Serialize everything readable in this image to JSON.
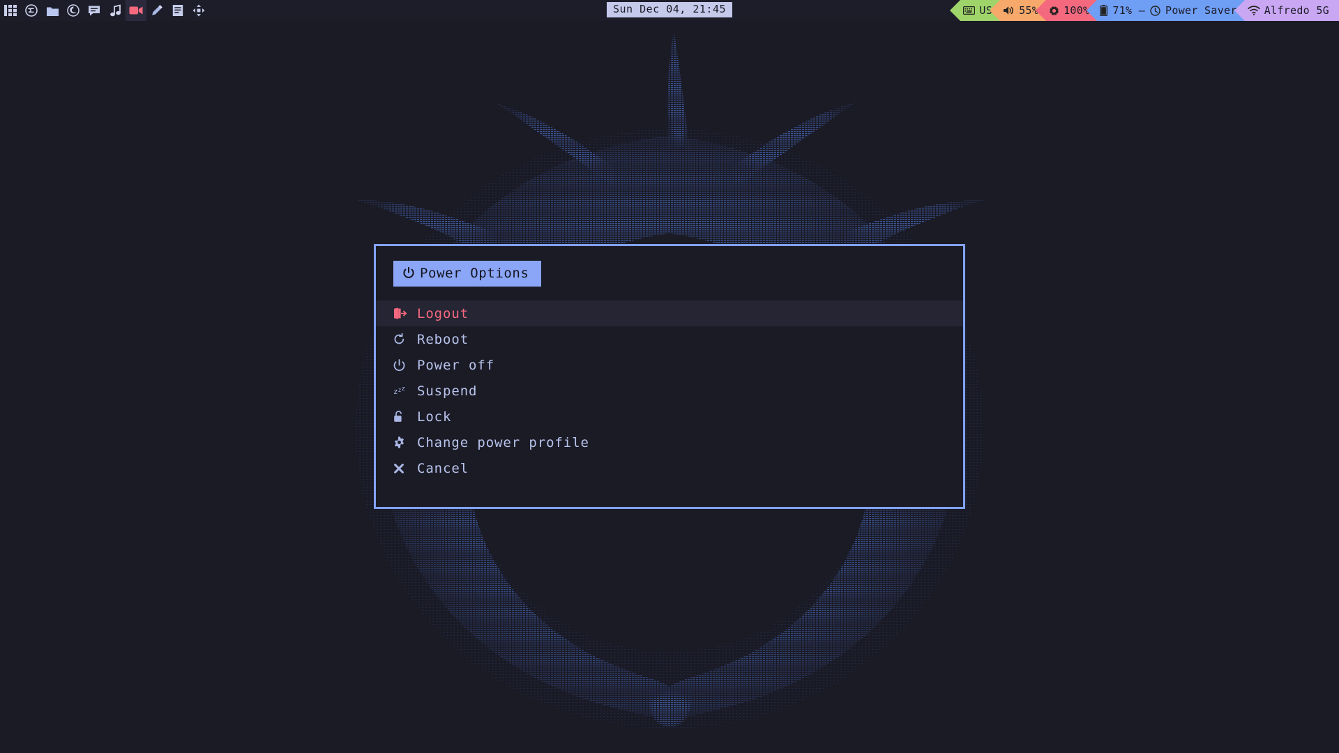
{
  "desktop": {
    "background_color": "#1b1b26",
    "wallpaper_name": "ascii-dithered-phoenix-wreath",
    "wallpaper_ink_color": "#3f5a9e"
  },
  "topbar": {
    "background_color": "#1d1d2a",
    "launchers": [
      {
        "name": "app-grid-icon",
        "title": "Applications"
      },
      {
        "name": "emacs-icon",
        "title": "Emacs"
      },
      {
        "name": "folder-icon",
        "title": "Files"
      },
      {
        "name": "firefox-icon",
        "title": "Firefox"
      },
      {
        "name": "chat-icon",
        "title": "Chat"
      },
      {
        "name": "music-note-icon",
        "title": "Music"
      },
      {
        "name": "video-camera-icon",
        "title": "Video",
        "active": true
      },
      {
        "name": "pencil-icon",
        "title": "Draw"
      },
      {
        "name": "document-icon",
        "title": "Notes"
      },
      {
        "name": "move-arrows-icon",
        "title": "Layout"
      }
    ],
    "clock": {
      "text": "Sun Dec 04, 21:45",
      "background_color": "#c5c9ea",
      "text_color": "#1b1b26"
    },
    "status_segments": [
      {
        "name": "keyboard-layout",
        "icon": "keyboard-icon",
        "label": "US",
        "color": "#9fd46a"
      },
      {
        "name": "volume",
        "icon": "speaker-icon",
        "label": "55%",
        "color": "#f6a96a"
      },
      {
        "name": "brightness",
        "icon": "brightness-icon",
        "label": "100%",
        "color": "#f4697e"
      },
      {
        "name": "battery",
        "icon": "battery-icon",
        "label": "71% –",
        "color": "#6f9ef5",
        "extra_icon": "clock-icon",
        "extra_label": "Power Saver"
      },
      {
        "name": "network",
        "icon": "wifi-icon",
        "label": "Alfredo 5G",
        "color": "#c9a7f3"
      }
    ]
  },
  "power_dialog": {
    "border_color": "#82a2fa",
    "background_color": "#1b1b26",
    "header": {
      "label": "Power Options",
      "icon": "power-icon",
      "background_color": "#8ba6f7",
      "text_color": "#15151f"
    },
    "selected_index": 0,
    "selected_text_color": "#f4697e",
    "selected_row_color": "#252534",
    "item_text_color": "#b8c4ec",
    "items": [
      {
        "label": "Logout",
        "icon": "logout-icon",
        "selected": true
      },
      {
        "label": "Reboot",
        "icon": "reboot-icon",
        "selected": false
      },
      {
        "label": "Power off",
        "icon": "power-icon",
        "selected": false
      },
      {
        "label": "Suspend",
        "icon": "zzz-icon",
        "selected": false
      },
      {
        "label": "Lock",
        "icon": "lock-icon",
        "selected": false
      },
      {
        "label": "Change power profile",
        "icon": "gear-icon",
        "selected": false
      },
      {
        "label": "Cancel",
        "icon": "close-icon",
        "selected": false
      }
    ]
  }
}
